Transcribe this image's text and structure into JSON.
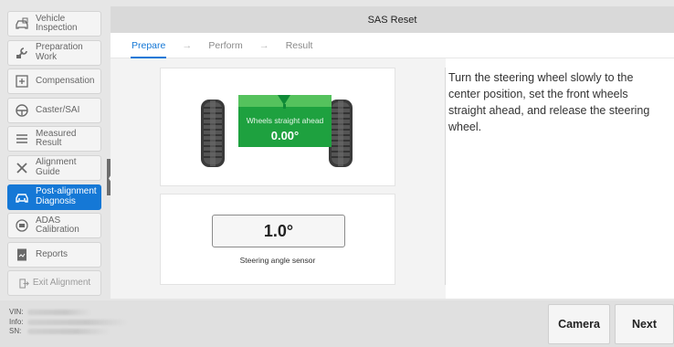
{
  "sidebar": {
    "items": [
      {
        "label": "Vehicle\nInspection",
        "icon": "car-inspect-icon"
      },
      {
        "label": "Preparation\nWork",
        "icon": "wrench-prep-icon"
      },
      {
        "label": "Compensation",
        "icon": "compensation-icon"
      },
      {
        "label": "Caster/SAI",
        "icon": "steering-wheel-icon"
      },
      {
        "label": "Measured\nResult",
        "icon": "list-icon"
      },
      {
        "label": "Alignment\nGuide",
        "icon": "tools-icon"
      },
      {
        "label": "Post-alignment\nDiagnosis",
        "icon": "car-diagnosis-icon"
      },
      {
        "label": "ADAS\nCalibration",
        "icon": "adas-icon"
      },
      {
        "label": "Reports",
        "icon": "report-icon"
      }
    ],
    "exit_label": "Exit Alignment",
    "active_index": 6,
    "active_color": "#1578d6"
  },
  "header": {
    "title": "SAS Reset"
  },
  "steps": {
    "prepare": "Prepare",
    "perform": "Perform",
    "result": "Result",
    "arrow": "→"
  },
  "visual": {
    "bar_label": "Wheels straight ahead",
    "bar_value": "0.00°",
    "bar_color": "#1ea13f"
  },
  "sensor": {
    "value": "1.0°",
    "label": "Steering angle sensor"
  },
  "instruction": "Turn the steering wheel slowly to the center position, set the front wheels straight ahead, and release the steering wheel.",
  "footer": {
    "vin_key": "VIN:",
    "info_key": "Info:",
    "sn_key": "SN:",
    "camera_label": "Camera",
    "next_label": "Next"
  }
}
